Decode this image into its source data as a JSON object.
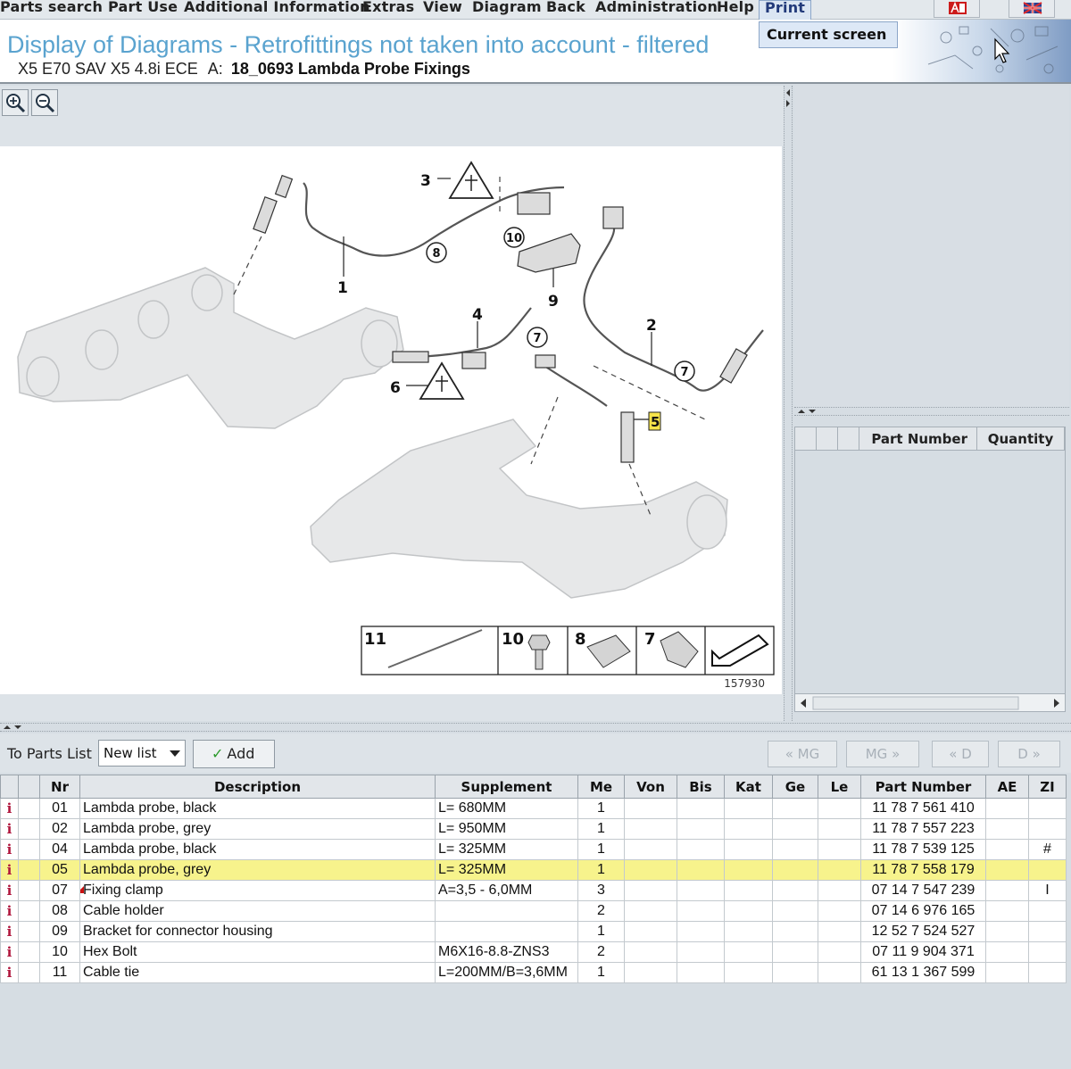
{
  "menu": {
    "items": [
      "Parts search",
      "Part Use",
      "Additional Information",
      "Extras",
      "View",
      "Diagram",
      "Back",
      "Administration",
      "Help"
    ],
    "print": "Print",
    "print_dropdown": "Current screen"
  },
  "header": {
    "title": "Display of Diagrams - Retrofittings not taken into account - filtered",
    "vehicle": "X5 E70 SAV X5 4.8i ECE",
    "group_prefix": "A:",
    "group": "18_0693 Lambda Probe Fixings"
  },
  "diagram": {
    "callouts": [
      "1",
      "2",
      "3",
      "4",
      "5",
      "6",
      "7",
      "8",
      "9",
      "10"
    ],
    "legend": [
      "11",
      "10",
      "8",
      "7"
    ],
    "image_number": "157930"
  },
  "right_panel": {
    "columns": [
      "Part Number",
      "Quantity"
    ]
  },
  "parts_toolbar": {
    "to_parts_list": "To Parts List",
    "list_value": "New list",
    "add": "Add",
    "nav": [
      "« MG",
      "MG »",
      "« D",
      "D »"
    ]
  },
  "parts_table": {
    "columns": [
      "Nr",
      "Description",
      "Supplement",
      "Me",
      "Von",
      "Bis",
      "Kat",
      "Ge",
      "Le",
      "Part Number",
      "AE",
      "ZI"
    ],
    "rows": [
      {
        "nr": "01",
        "description": "Lambda probe, black",
        "supplement": "L= 680MM",
        "me": "1",
        "part_number": "11 78 7 561 410",
        "zi": "",
        "note": false,
        "selected": false
      },
      {
        "nr": "02",
        "description": "Lambda probe, grey",
        "supplement": "L= 950MM",
        "me": "1",
        "part_number": "11 78 7 557 223",
        "zi": "",
        "note": false,
        "selected": false
      },
      {
        "nr": "04",
        "description": "Lambda probe, black",
        "supplement": "L= 325MM",
        "me": "1",
        "part_number": "11 78 7 539 125",
        "zi": "#",
        "note": false,
        "selected": false
      },
      {
        "nr": "05",
        "description": "Lambda probe, grey",
        "supplement": "L= 325MM",
        "me": "1",
        "part_number": "11 78 7 558 179",
        "zi": "",
        "note": false,
        "selected": true
      },
      {
        "nr": "07",
        "description": "Fixing clamp",
        "supplement": "A=3,5 - 6,0MM",
        "me": "3",
        "part_number": "07 14 7 547 239",
        "zi": "I",
        "note": true,
        "selected": false
      },
      {
        "nr": "08",
        "description": "Cable holder",
        "supplement": "",
        "me": "2",
        "part_number": "07 14 6 976 165",
        "zi": "",
        "note": false,
        "selected": false
      },
      {
        "nr": "09",
        "description": "Bracket for connector housing",
        "supplement": "",
        "me": "1",
        "part_number": "12 52 7 524 527",
        "zi": "",
        "note": false,
        "selected": false
      },
      {
        "nr": "10",
        "description": "Hex Bolt",
        "supplement": "M6X16-8.8-ZNS3",
        "me": "2",
        "part_number": "07 11 9 904 371",
        "zi": "",
        "note": false,
        "selected": false
      },
      {
        "nr": "11",
        "description": "Cable tie",
        "supplement": "L=200MM/B=3,6MM",
        "me": "1",
        "part_number": "61 13 1 367 599",
        "zi": "",
        "note": false,
        "selected": false
      }
    ]
  },
  "colors": {
    "title": "#5aa3cf",
    "selected_row": "#f7f38c",
    "info_icon": "#b0163d"
  }
}
